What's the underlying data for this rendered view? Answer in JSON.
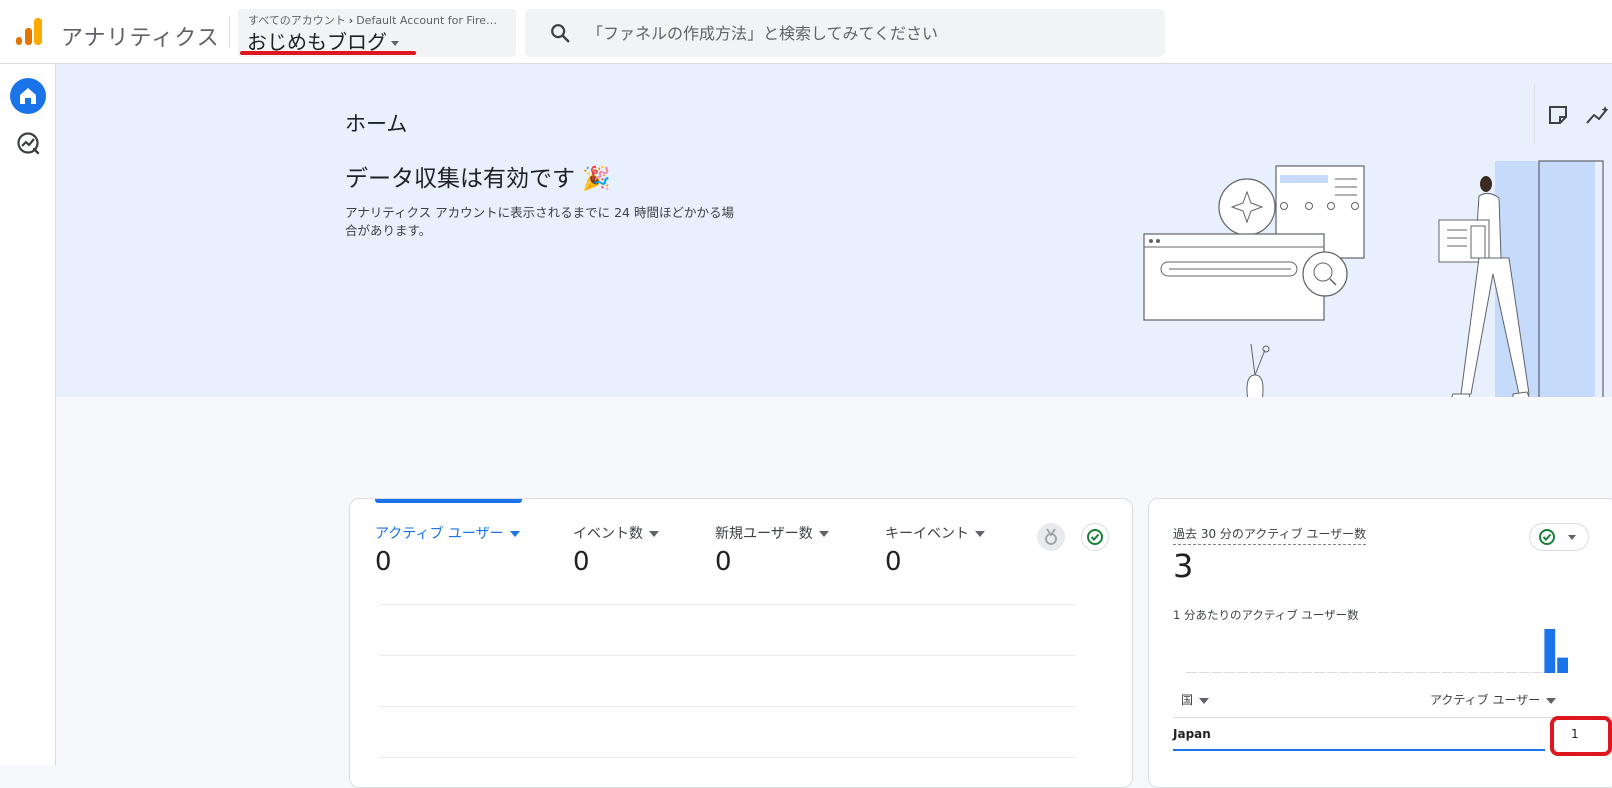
{
  "header": {
    "app_title": "アナリティクス",
    "breadcrumb": {
      "root": "すべてのアカウント",
      "account": "Default Account for Fire…"
    },
    "property_name": "おじめもブログ",
    "search": {
      "placeholder": "「ファネルの作成方法」と検索してみてください"
    }
  },
  "leftnav": {
    "items": [
      {
        "icon": "home-icon",
        "selected": true
      },
      {
        "icon": "reports-icon",
        "selected": false
      }
    ]
  },
  "hero": {
    "page_title": "ホーム",
    "headline": "データ収集は有効です 🎉",
    "description": "アナリティクス アカウントに表示されるまでに 24 時間ほどかかる場合があります。",
    "tools": [
      "notes-icon",
      "insights-icon"
    ]
  },
  "metrics_card": {
    "metrics": [
      {
        "label": "アクティブ ユーザー",
        "value": "0",
        "active": true
      },
      {
        "label": "イベント数",
        "value": "0",
        "active": false
      },
      {
        "label": "新規ユーザー数",
        "value": "0",
        "active": false
      },
      {
        "label": "キーイベント",
        "value": "0",
        "active": false
      }
    ],
    "icons": [
      "medal-icon",
      "check-circle-icon"
    ]
  },
  "realtime_card": {
    "title": "過去 30 分のアクティブ ユーザー数",
    "value": "3",
    "subtitle": "1 分あたりのアクティブ ユーザー数",
    "per_minute": [
      0,
      0,
      0,
      0,
      0,
      0,
      0,
      0,
      0,
      0,
      0,
      0,
      0,
      0,
      0,
      0,
      0,
      0,
      0,
      0,
      0,
      0,
      0,
      0,
      0,
      0,
      0,
      0,
      2,
      0.7
    ],
    "table": {
      "col_country": "国",
      "col_users": "アクティブ ユーザー",
      "rows": [
        {
          "country": "Japan",
          "users": "1"
        }
      ]
    },
    "colors": {
      "accent": "#1a73e8",
      "highlight": "#e0161e"
    }
  }
}
